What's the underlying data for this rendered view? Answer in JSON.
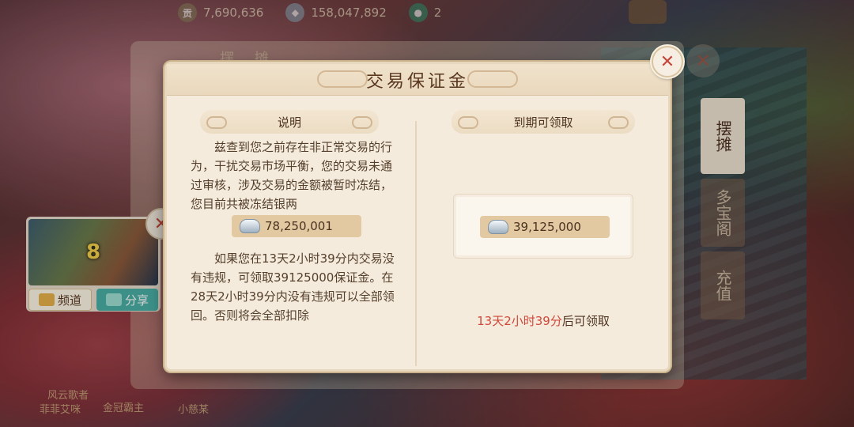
{
  "topbar": {
    "resources": [
      {
        "icon": "ingot-icon",
        "value": "7,690,636"
      },
      {
        "icon": "silver-icon",
        "value": "158,047,892"
      },
      {
        "icon": "jade-icon",
        "value": "2"
      }
    ]
  },
  "under_panel": {
    "tab_label": "摆 摊"
  },
  "side_tabs": [
    {
      "label": "摆摊",
      "active": true
    },
    {
      "label": "多宝阁",
      "active": false
    },
    {
      "label": "充值",
      "active": false
    }
  ],
  "video_widget": {
    "number": "8",
    "channel_label": "频道",
    "share_label": "分享"
  },
  "bottom_names": [
    "风云歌者",
    "菲菲艾咪",
    "金冠霸主",
    "小慈某"
  ],
  "modal": {
    "title": "交易保证金",
    "left": {
      "header": "说明",
      "paragraph1": "兹查到您之前存在非正常交易的行为，干扰交易市场平衡，您的交易未通过审核，涉及交易的金额被暂时冻结，您目前共被冻结银两",
      "frozen_amount": "78,250,001",
      "paragraph2": "如果您在13天2小时39分内交易没有违规，可领取39125000保证金。在28天2小时39分内没有违规可以全部领回。否则将会全部扣除"
    },
    "right": {
      "header": "到期可领取",
      "claim_amount": "39,125,000",
      "countdown_time": "13天2小时39分",
      "countdown_suffix": "后可领取"
    }
  },
  "colors": {
    "panel_bg": "#f4ebdd",
    "amount_bar": "#e2c9a2",
    "countdown_red": "#d0473a",
    "close_red": "#c5463a"
  }
}
